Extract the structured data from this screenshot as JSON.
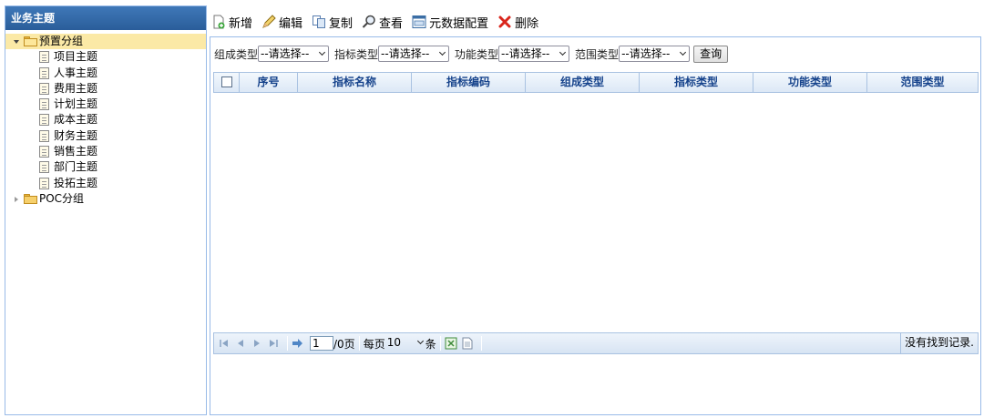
{
  "left_panel": {
    "title": "业务主题",
    "tree": [
      {
        "label": "预置分组",
        "expanded": true,
        "selected": true,
        "children": [
          "项目主题",
          "人事主题",
          "费用主题",
          "计划主题",
          "成本主题",
          "财务主题",
          "销售主题",
          "部门主题",
          "投拓主题"
        ]
      },
      {
        "label": "POC分组",
        "expanded": false,
        "selected": false,
        "children": []
      }
    ]
  },
  "toolbar": {
    "add": "新增",
    "edit": "编辑",
    "copy": "复制",
    "view": "查看",
    "meta_config": "元数据配置",
    "delete": "删除"
  },
  "filters": {
    "composition_label": "组成类型",
    "indicator_label": "指标类型",
    "function_label": "功能类型",
    "scope_label": "范围类型",
    "placeholder": "--请选择--",
    "query_button": "查询"
  },
  "grid": {
    "columns": [
      "序号",
      "指标名称",
      "指标编码",
      "组成类型",
      "指标类型",
      "功能类型",
      "范围类型"
    ],
    "rows": []
  },
  "pager": {
    "current_page": "1",
    "total_pages": "/0页",
    "per_page_label": "每页",
    "page_size": "10",
    "unit": "条",
    "status": "没有找到记录."
  },
  "colors": {
    "title_bar": "#2a5d9a",
    "border": "#99bbe8",
    "header_text": "#15428b",
    "selected_row": "#fbe9a6"
  }
}
